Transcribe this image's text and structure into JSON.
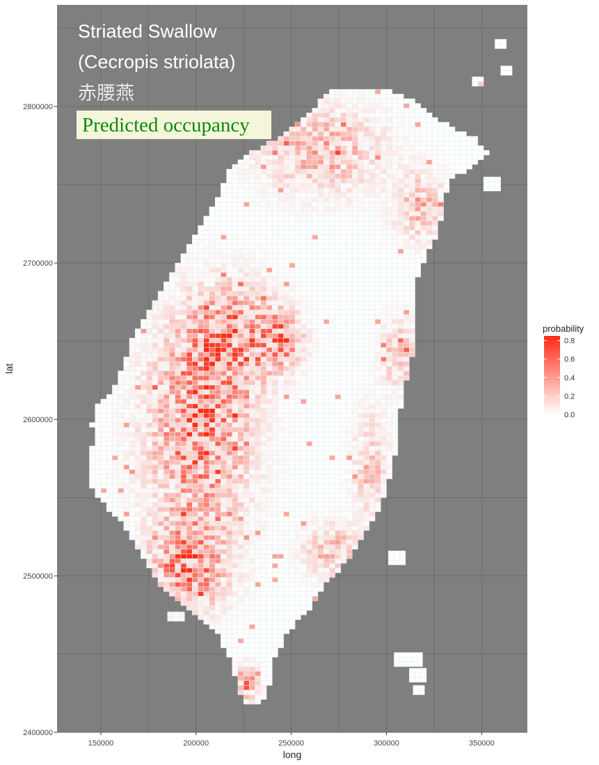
{
  "colors": {
    "panel_background": "#7f7f7f",
    "gridline": "#6b6b6b",
    "tile_low": "#ffffff",
    "tile_high": "#ff2a14",
    "tile_border": "#dfeef0",
    "title_text": "#ffffff",
    "badge_fill": "#f5f5dc",
    "badge_text": "#0a8a0a"
  },
  "title": {
    "line1": "Striated Swallow",
    "line2": "(Cecropis striolata)",
    "line3": "赤腰燕",
    "badge": "Predicted occupancy"
  },
  "chart_data": {
    "type": "heatmap",
    "xlabel": "long",
    "ylabel": "lat",
    "xlim": [
      127000,
      374000
    ],
    "ylim": [
      2400000,
      2865000
    ],
    "x_ticks": [
      150000,
      200000,
      250000,
      300000,
      350000
    ],
    "x_tick_labels": [
      "150000",
      "200000",
      "250000",
      "300000",
      "350000"
    ],
    "y_ticks": [
      2400000,
      2500000,
      2600000,
      2700000,
      2800000
    ],
    "y_tick_labels": [
      "2400000",
      "2500000",
      "2600000",
      "2700000",
      "2800000"
    ],
    "cell_size": 3000,
    "value_range": [
      0,
      0.85
    ],
    "legend": {
      "title": "probability",
      "breaks": [
        0.8,
        0.6,
        0.4,
        0.2,
        0.0
      ],
      "labels": [
        "0.8",
        "0.6",
        "0.4",
        "0.2",
        "0.0"
      ],
      "position": "right"
    },
    "main_island": [
      {
        "lat": 2418000,
        "x_min": 223000,
        "x_max": 233000
      },
      {
        "lat": 2430000,
        "x_min": 220000,
        "x_max": 238000
      },
      {
        "lat": 2446000,
        "x_min": 216000,
        "x_max": 240000
      },
      {
        "lat": 2462000,
        "x_min": 210000,
        "x_max": 246000
      },
      {
        "lat": 2478000,
        "x_min": 195000,
        "x_max": 258000
      },
      {
        "lat": 2495000,
        "x_min": 178000,
        "x_max": 268000
      },
      {
        "lat": 2510000,
        "x_min": 170000,
        "x_max": 279000
      },
      {
        "lat": 2528000,
        "x_min": 162000,
        "x_max": 288000
      },
      {
        "lat": 2545000,
        "x_min": 150000,
        "x_max": 296000
      },
      {
        "lat": 2555000,
        "x_min": 143000,
        "x_max": 299000
      },
      {
        "lat": 2560000,
        "x_min": 141000,
        "x_max": 300000
      },
      {
        "lat": 2575000,
        "x_min": 143000,
        "x_max": 303000
      },
      {
        "lat": 2585000,
        "x_min": 145000,
        "x_max": 304000
      },
      {
        "lat": 2595000,
        "x_min": 144000,
        "x_max": 304000
      },
      {
        "lat": 2605000,
        "x_min": 145000,
        "x_max": 306000
      },
      {
        "lat": 2615000,
        "x_min": 153000,
        "x_max": 307000
      },
      {
        "lat": 2625000,
        "x_min": 158000,
        "x_max": 309000
      },
      {
        "lat": 2640000,
        "x_min": 163000,
        "x_max": 312000
      },
      {
        "lat": 2650000,
        "x_min": 165000,
        "x_max": 314000
      },
      {
        "lat": 2660000,
        "x_min": 170000,
        "x_max": 314000
      },
      {
        "lat": 2680000,
        "x_min": 180000,
        "x_max": 312000
      },
      {
        "lat": 2700000,
        "x_min": 190000,
        "x_max": 318000
      },
      {
        "lat": 2720000,
        "x_min": 200000,
        "x_max": 326000
      },
      {
        "lat": 2740000,
        "x_min": 210000,
        "x_max": 329000
      },
      {
        "lat": 2752000,
        "x_min": 214000,
        "x_max": 332000
      },
      {
        "lat": 2762000,
        "x_min": 218000,
        "x_max": 346000
      },
      {
        "lat": 2770000,
        "x_min": 229000,
        "x_max": 352000
      },
      {
        "lat": 2778000,
        "x_min": 241000,
        "x_max": 345000
      },
      {
        "lat": 2790000,
        "x_min": 255000,
        "x_max": 326000
      },
      {
        "lat": 2802000,
        "x_min": 264000,
        "x_max": 312000
      },
      {
        "lat": 2808000,
        "x_min": 270000,
        "x_max": 300000
      }
    ],
    "islands": [
      {
        "x": 351000,
        "y": 2746000,
        "w": 7000,
        "h": 7000
      },
      {
        "x": 345000,
        "y": 2813000,
        "w": 5000,
        "h": 5000
      },
      {
        "x": 360000,
        "y": 2820000,
        "w": 6000,
        "h": 5000
      },
      {
        "x": 357000,
        "y": 2837000,
        "w": 6000,
        "h": 5000
      },
      {
        "x": 301000,
        "y": 2507000,
        "w": 9000,
        "h": 8000
      },
      {
        "x": 185000,
        "y": 2471000,
        "w": 7000,
        "h": 6000
      },
      {
        "x": 304000,
        "y": 2442000,
        "w": 13000,
        "h": 7000
      },
      {
        "x": 312000,
        "y": 2432000,
        "w": 8000,
        "h": 8000
      },
      {
        "x": 314000,
        "y": 2424000,
        "w": 6000,
        "h": 6000
      }
    ],
    "hotspots": [
      {
        "x": 200000,
        "y": 2590000,
        "sx": 24000,
        "sy": 60000,
        "amp": 0.75
      },
      {
        "x": 195000,
        "y": 2505000,
        "sx": 18000,
        "sy": 25000,
        "amp": 0.7
      },
      {
        "x": 218000,
        "y": 2650000,
        "sx": 22000,
        "sy": 30000,
        "amp": 0.7
      },
      {
        "x": 243000,
        "y": 2650000,
        "sx": 10000,
        "sy": 15000,
        "amp": 0.65
      },
      {
        "x": 265000,
        "y": 2770000,
        "sx": 28000,
        "sy": 25000,
        "amp": 0.45
      },
      {
        "x": 316000,
        "y": 2735000,
        "sx": 12000,
        "sy": 20000,
        "amp": 0.4
      },
      {
        "x": 305000,
        "y": 2640000,
        "sx": 8000,
        "sy": 20000,
        "amp": 0.4
      },
      {
        "x": 270000,
        "y": 2515000,
        "sx": 14000,
        "sy": 15000,
        "amp": 0.4
      },
      {
        "x": 225000,
        "y": 2430000,
        "sx": 6000,
        "sy": 10000,
        "amp": 0.6
      },
      {
        "x": 290000,
        "y": 2570000,
        "sx": 8000,
        "sy": 30000,
        "amp": 0.35
      }
    ]
  }
}
